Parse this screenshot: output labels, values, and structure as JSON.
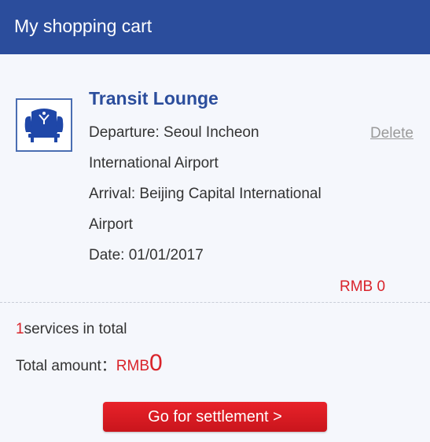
{
  "header": {
    "title": "My shopping cart"
  },
  "cart_item": {
    "icon": "armchair-icon",
    "title": "Transit Lounge",
    "departure_line1": "Departure: Seoul Incheon",
    "departure_line2": "International Airport",
    "arrival_line1": "Arrival: Beijing Capital International",
    "arrival_line2": "Airport",
    "date": "Date: 01/01/2017",
    "delete_label": "Delete",
    "price": "RMB 0"
  },
  "summary": {
    "service_count": "1",
    "services_text": "services in total",
    "total_label": "Total amount：",
    "total_currency": "RMB",
    "total_value": "0"
  },
  "actions": {
    "settle_label": "Go for settlement >"
  },
  "colors": {
    "header_bg": "#2b4d9c",
    "accent_red": "#d9232a",
    "page_bg": "#f5f7fc"
  }
}
